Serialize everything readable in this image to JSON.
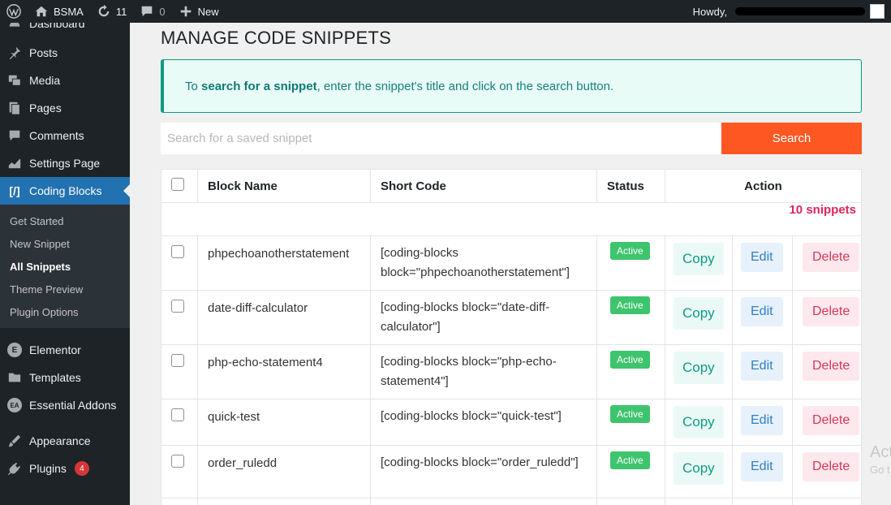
{
  "adminbar": {
    "site_name": "BSMA",
    "updates_count": "11",
    "comments_count": "0",
    "new_label": "New",
    "howdy": "Howdy,"
  },
  "sidebar": {
    "top_partial": "Dashboard",
    "items": [
      {
        "label": "Posts",
        "icon": "pin-icon"
      },
      {
        "label": "Media",
        "icon": "media-icon"
      },
      {
        "label": "Pages",
        "icon": "pages-icon"
      },
      {
        "label": "Comments",
        "icon": "comment-icon"
      },
      {
        "label": "Settings Page",
        "icon": "chart-icon"
      },
      {
        "label": "Coding Blocks",
        "icon": "code-icon"
      }
    ],
    "active_icon_text": "[/]",
    "submenu": [
      "Get Started",
      "New Snippet",
      "All Snippets",
      "Theme Preview",
      "Plugin Options"
    ],
    "items2": [
      {
        "label": "Elementor",
        "icon": "elementor-icon"
      },
      {
        "label": "Templates",
        "icon": "folder-icon"
      },
      {
        "label": "Essential Addons",
        "icon": "ea-icon"
      }
    ],
    "items3": [
      {
        "label": "Appearance",
        "icon": "brush-icon"
      },
      {
        "label": "Plugins",
        "icon": "plug-icon",
        "badge": "4"
      }
    ]
  },
  "page": {
    "title": "MANAGE CODE SNIPPETS",
    "notice_prefix": "To ",
    "notice_bold": "search for a snippet",
    "notice_suffix": ", enter the snippet's title and click on the search button.",
    "search_placeholder": "Search for a saved snippet",
    "search_button": "Search"
  },
  "table": {
    "headers": {
      "name": "Block Name",
      "code": "Short Code",
      "status": "Status",
      "action": "Action"
    },
    "count_label": "10 snippets",
    "copy_label": "Copy",
    "edit_label": "Edit",
    "delete_label": "Delete",
    "rows": [
      {
        "name": "phpechoanotherstatement",
        "code": "[coding-blocks block=\"phpechoanotherstatement\"]",
        "status": "Active"
      },
      {
        "name": "date-diff-calculator",
        "code": "[coding-blocks block=\"date-diff-calculator\"]",
        "status": "Active"
      },
      {
        "name": "php-echo-statement4",
        "code": "[coding-blocks block=\"php-echo-statement4\"]",
        "status": "Active"
      },
      {
        "name": "quick-test",
        "code": "[coding-blocks block=\"quick-test\"]",
        "status": "Active"
      },
      {
        "name": "order_ruledd",
        "code": "[coding-blocks block=\"order_ruledd\"]",
        "status": "Active"
      }
    ]
  },
  "watermark": {
    "line1": "Act",
    "line2": "Go t"
  }
}
